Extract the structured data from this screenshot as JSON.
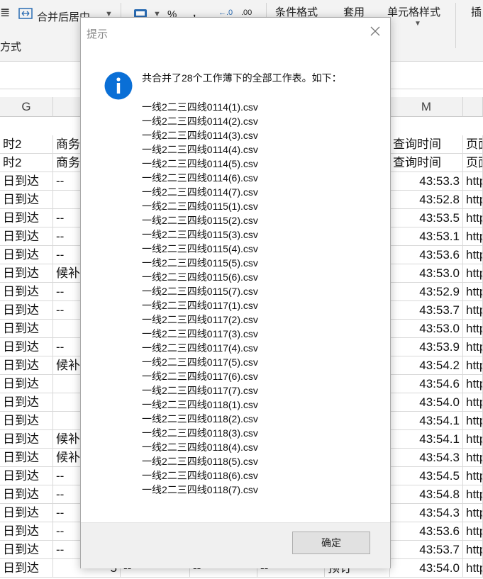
{
  "ribbon": {
    "merge_center_label": "合并后居中",
    "percent_symbol": "%",
    "comma_symbol": ",",
    "decimal_inc_label": ".0",
    "decimal_dec_label": ".00",
    "conditional_format_label": "条件格式",
    "apply_table_label": "套用",
    "cell_style_label": "单元格样式",
    "insert_label": "插",
    "style_group_label": "方式"
  },
  "sheet": {
    "col_headers": [
      "G",
      "M"
    ],
    "header_rows": [
      {
        "g": "时2",
        "h": "商务",
        "m": "查询时间",
        "n": "页面"
      },
      {
        "g": "时2",
        "h": "商务",
        "m": "查询时间",
        "n": "页面"
      }
    ],
    "rows": [
      {
        "g": "日到达",
        "h": "--",
        "m": "43:53.3",
        "n": "http"
      },
      {
        "g": "日到达",
        "h": "",
        "m": "43:52.8",
        "n": "http"
      },
      {
        "g": "日到达",
        "h": "--",
        "m": "43:53.5",
        "n": "http"
      },
      {
        "g": "日到达",
        "h": "--",
        "m": "43:53.1",
        "n": "http"
      },
      {
        "g": "日到达",
        "h": "--",
        "m": "43:53.6",
        "n": "http"
      },
      {
        "g": "日到达",
        "h": "候补",
        "m": "43:53.0",
        "n": "http"
      },
      {
        "g": "日到达",
        "h": "--",
        "m": "43:52.9",
        "n": "http"
      },
      {
        "g": "日到达",
        "h": "--",
        "m": "43:53.7",
        "n": "http"
      },
      {
        "g": "日到达",
        "h": "",
        "m": "43:53.0",
        "n": "http"
      },
      {
        "g": "日到达",
        "h": "--",
        "m": "43:53.9",
        "n": "http"
      },
      {
        "g": "日到达",
        "h": "候补",
        "m": "43:54.2",
        "n": "http"
      },
      {
        "g": "日到达",
        "h": "",
        "m": "43:54.6",
        "n": "http"
      },
      {
        "g": "日到达",
        "h": "",
        "m": "43:54.0",
        "n": "http"
      },
      {
        "g": "日到达",
        "h": "",
        "m": "43:54.1",
        "n": "http"
      },
      {
        "g": "日到达",
        "h": "候补",
        "m": "43:54.1",
        "n": "http"
      },
      {
        "g": "日到达",
        "h": "候补",
        "m": "43:54.3",
        "n": "http"
      },
      {
        "g": "日到达",
        "h": "--",
        "m": "43:54.5",
        "n": "http"
      },
      {
        "g": "日到达",
        "h": "--",
        "m": "43:54.8",
        "n": "http"
      },
      {
        "g": "日到达",
        "h": "--",
        "m": "43:54.3",
        "n": "http"
      },
      {
        "g": "日到达",
        "h": "--",
        "m": "43:53.6",
        "n": "http"
      },
      {
        "g": "日到达",
        "h": "--",
        "m": "43:53.7",
        "n": "http"
      }
    ],
    "last_row": {
      "g": "日到达",
      "h": "5",
      "i": "--",
      "j": "--",
      "k": "--",
      "l": "预订",
      "m": "43:54.0",
      "n": "http"
    }
  },
  "dialog": {
    "title": "提示",
    "message": "共合并了28个工作薄下的全部工作表。如下：",
    "files": [
      "一线2二三四线0114(1).csv",
      "一线2二三四线0114(2).csv",
      "一线2二三四线0114(3).csv",
      "一线2二三四线0114(4).csv",
      "一线2二三四线0114(5).csv",
      "一线2二三四线0114(6).csv",
      "一线2二三四线0114(7).csv",
      "一线2二三四线0115(1).csv",
      "一线2二三四线0115(2).csv",
      "一线2二三四线0115(3).csv",
      "一线2二三四线0115(4).csv",
      "一线2二三四线0115(5).csv",
      "一线2二三四线0115(6).csv",
      "一线2二三四线0115(7).csv",
      "一线2二三四线0117(1).csv",
      "一线2二三四线0117(2).csv",
      "一线2二三四线0117(3).csv",
      "一线2二三四线0117(4).csv",
      "一线2二三四线0117(5).csv",
      "一线2二三四线0117(6).csv",
      "一线2二三四线0117(7).csv",
      "一线2二三四线0118(1).csv",
      "一线2二三四线0118(2).csv",
      "一线2二三四线0118(3).csv",
      "一线2二三四线0118(4).csv",
      "一线2二三四线0118(5).csv",
      "一线2二三四线0118(6).csv",
      "一线2二三四线0118(7).csv"
    ],
    "ok_label": "确定",
    "info_icon": "info-icon",
    "close_icon": "close-icon",
    "accent_color": "#0a6fd6"
  }
}
